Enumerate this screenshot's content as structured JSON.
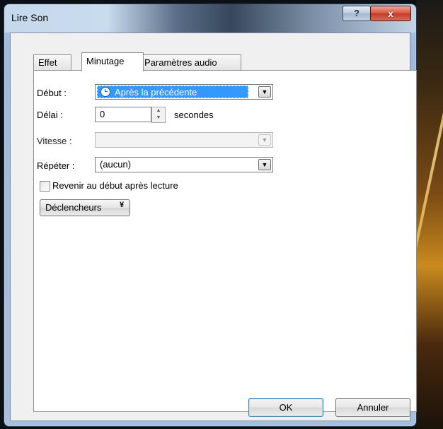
{
  "window": {
    "title": "Lire Son",
    "help_label": "?",
    "close_label": "x"
  },
  "tabs": [
    {
      "label": "Effet",
      "active": false
    },
    {
      "label": "Minutage",
      "active": true
    },
    {
      "label": "Paramètres audio",
      "active": false
    }
  ],
  "form": {
    "debut_label": "Début :",
    "debut_value": "Après la précédente",
    "delai_label": "Délai :",
    "delai_value": "0",
    "delai_unit": "secondes",
    "vitesse_label": "Vitesse :",
    "vitesse_value": "",
    "repeter_label": "Répéter :",
    "repeter_value": "(aucun)",
    "rewind_label": "Revenir au début après lecture",
    "rewind_checked": false,
    "triggers_label": "Déclencheurs"
  },
  "buttons": {
    "ok": "OK",
    "cancel": "Annuler"
  },
  "colors": {
    "selection": "#3399ff",
    "close_button": "#d9533f"
  }
}
